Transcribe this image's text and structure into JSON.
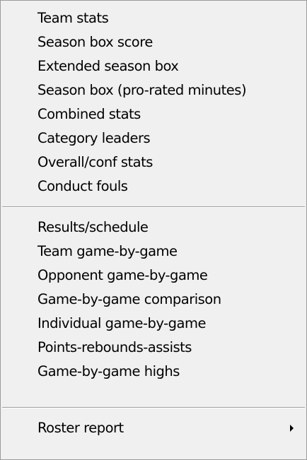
{
  "menu": {
    "group1": [
      "Team stats",
      "Season box score",
      "Extended season box",
      "Season box (pro-rated minutes)",
      "Combined stats",
      "Category leaders",
      "Overall/conf stats",
      "Conduct fouls"
    ],
    "group2": [
      "Results/schedule",
      "Team game-by-game",
      "Opponent game-by-game",
      "Game-by-game comparison",
      "Individual game-by-game",
      "Points-rebounds-assists",
      "Game-by-game highs"
    ],
    "group3": [
      "Roster report"
    ]
  }
}
